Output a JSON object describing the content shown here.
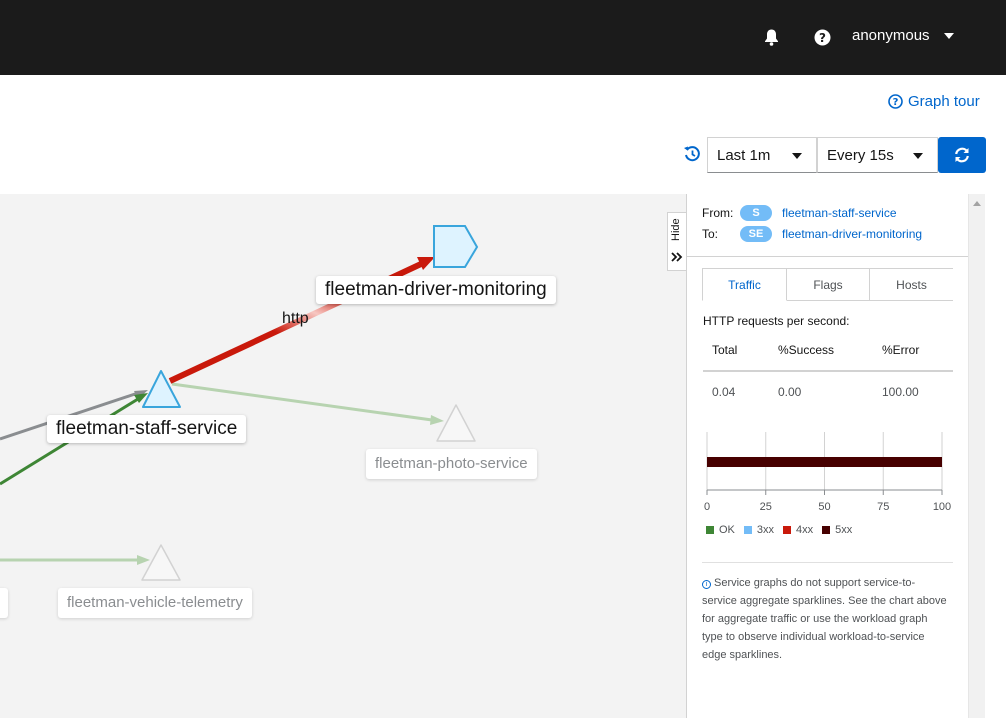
{
  "masthead": {
    "username": "anonymous",
    "bell_icon": "bell-icon",
    "help_icon": "question-circle-icon"
  },
  "toolbar": {
    "graph_tour_label": "Graph tour",
    "duration": "Last 1m",
    "refresh_interval": "Every 15s",
    "refresh_icon": "sync-icon",
    "history_icon": "history-icon"
  },
  "graph": {
    "nodes": [
      {
        "name": "fleetman-driver-monitoring",
        "shape": "pentagon",
        "selected": true
      },
      {
        "name": "fleetman-staff-service",
        "shape": "triangle",
        "selected": true
      },
      {
        "name": "fleetman-photo-service",
        "shape": "triangle",
        "selected": false
      },
      {
        "name": "fleetman-vehicle-telemetry",
        "shape": "triangle",
        "selected": false
      }
    ],
    "edge_label": "http",
    "hide_label": "Hide",
    "colors": {
      "error_edge": "#c9190b",
      "ok_edge": "#3e8635",
      "faded_ok_edge": "#b7d3b0",
      "neutral_edge": "#8a8d90",
      "selected_node_fill": "#def3ff",
      "selected_node_stroke": "#39a5dc"
    }
  },
  "panel": {
    "from_label": "From:",
    "to_label": "To:",
    "from_badge": "S",
    "to_badge": "SE",
    "from_service": "fleetman-staff-service",
    "to_service": "fleetman-driver-monitoring",
    "tabs": [
      "Traffic",
      "Flags",
      "Hosts"
    ],
    "active_tab": "Traffic",
    "requests_heading": "HTTP requests per second:",
    "table": {
      "headers": [
        "Total",
        "%Success",
        "%Error"
      ],
      "row": [
        "0.04",
        "0.00",
        "100.00"
      ]
    },
    "legend": [
      {
        "label": "OK",
        "color": "#3e8635"
      },
      {
        "label": "3xx",
        "color": "#73bcf7"
      },
      {
        "label": "4xx",
        "color": "#c9190b"
      },
      {
        "label": "5xx",
        "color": "#470000"
      }
    ],
    "info_text": "Service graphs do not support service-to-service aggregate sparklines. See the chart above for aggregate traffic or use the workload graph type to observe individual workload-to-service edge sparklines."
  },
  "chart_data": {
    "type": "bar",
    "orientation": "horizontal",
    "categories": [
      ""
    ],
    "series": [
      {
        "name": "OK",
        "values": [
          0
        ]
      },
      {
        "name": "3xx",
        "values": [
          0
        ]
      },
      {
        "name": "4xx",
        "values": [
          0
        ]
      },
      {
        "name": "5xx",
        "values": [
          100
        ]
      }
    ],
    "xticks": [
      "0",
      "25",
      "50",
      "75",
      "100"
    ],
    "xlim": [
      0,
      100
    ],
    "grid": true,
    "legend": "bottom"
  }
}
